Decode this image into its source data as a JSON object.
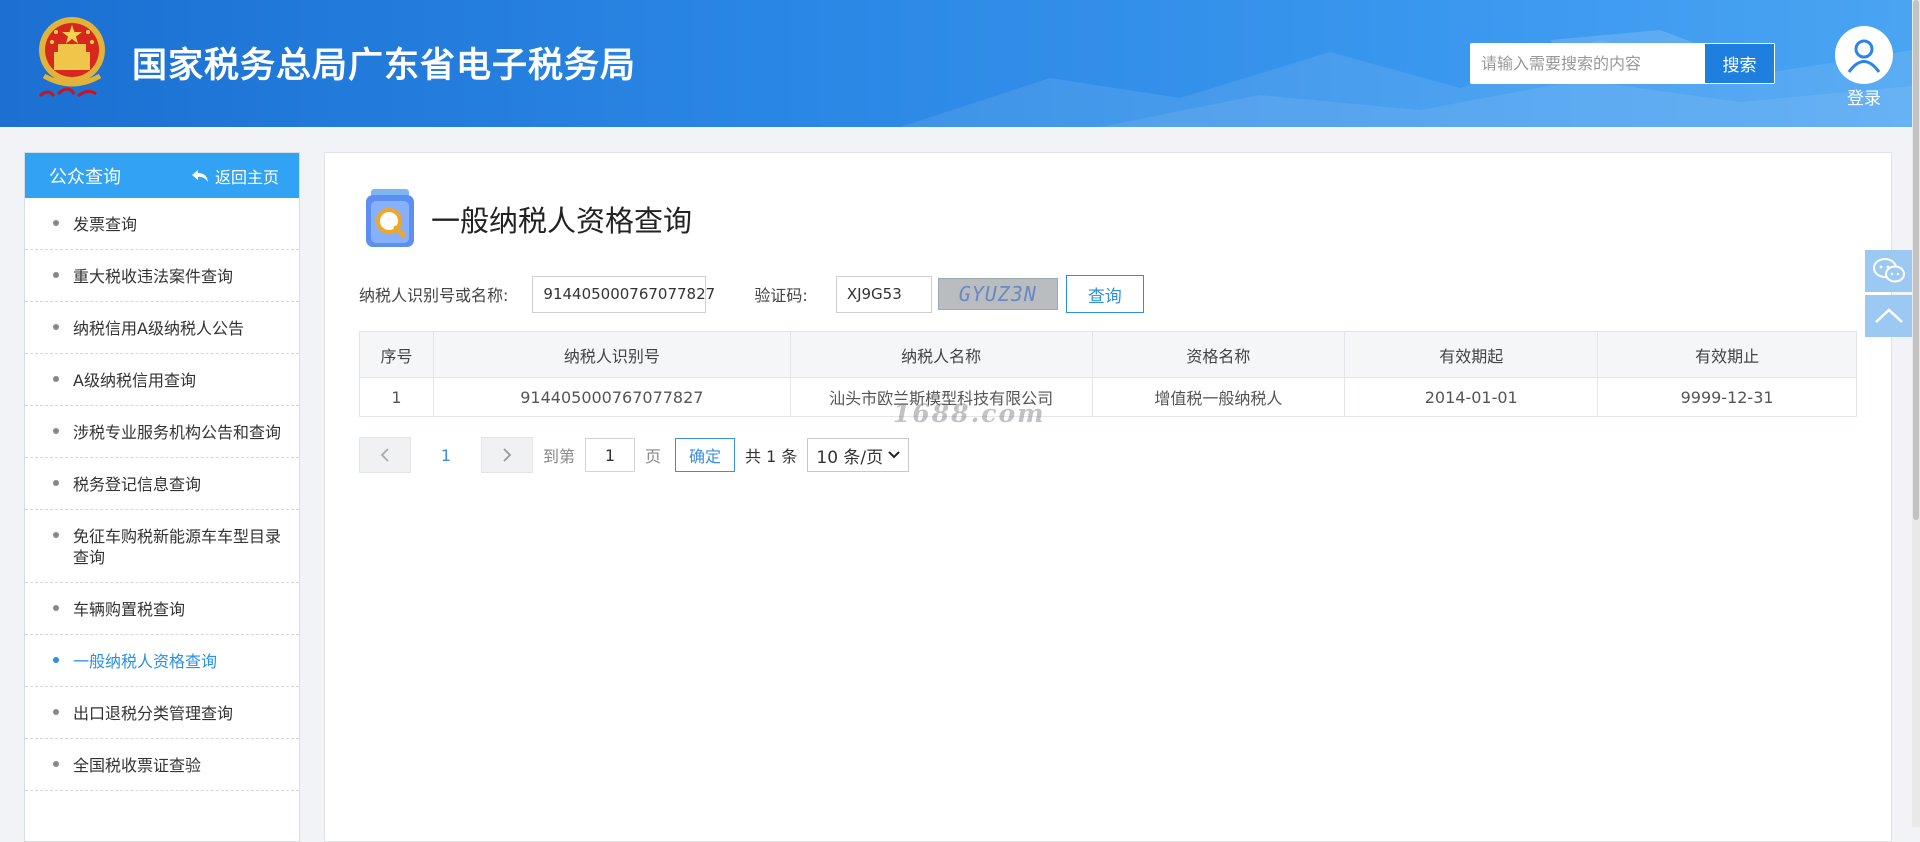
{
  "header": {
    "emblem_text": "中国税务",
    "site_title": "国家税务总局广东省电子税务局",
    "search": {
      "placeholder": "请输入需要搜索的内容",
      "button_label": "搜索"
    },
    "login_label": "登录"
  },
  "sidebar": {
    "title": "公众查询",
    "back_label": "返回主页",
    "items": [
      {
        "label": "发票查询"
      },
      {
        "label": "重大税收违法案件查询"
      },
      {
        "label": "纳税信用A级纳税人公告"
      },
      {
        "label": "A级纳税信用查询"
      },
      {
        "label": "涉税专业服务机构公告和查询"
      },
      {
        "label": "税务登记信息查询"
      },
      {
        "label": "免征车购税新能源车车型目录查询"
      },
      {
        "label": "车辆购置税查询"
      },
      {
        "label": "一般纳税人资格查询",
        "active": true
      },
      {
        "label": "出口退税分类管理查询"
      },
      {
        "label": "全国税收票证查验"
      }
    ]
  },
  "main": {
    "title": "一般纳税人资格查询",
    "form": {
      "taxpayer_label": "纳税人识别号或名称:",
      "taxpayer_value": "914405000767077827",
      "captcha_label": "验证码:",
      "captcha_value": "XJ9G53",
      "captcha_image_text": "GYUZ3N",
      "query_button": "查询"
    },
    "table": {
      "headers": [
        "序号",
        "纳税人识别号",
        "纳税人名称",
        "资格名称",
        "有效期起",
        "有效期止"
      ],
      "rows": [
        [
          "1",
          "914405000767077827",
          "汕头市欧兰斯模型科技有限公司",
          "增值税一般纳税人",
          "2014-01-01",
          "9999-12-31"
        ]
      ]
    },
    "watermark": "1688.com",
    "pager": {
      "current_page": "1",
      "goto_label": "到第",
      "goto_value": "1",
      "page_unit": "页",
      "confirm": "确定",
      "total": "共 1 条",
      "page_size": "10 条/页"
    }
  },
  "colors": {
    "header_blue": "#2a86e4",
    "sidebar_head": "#32a3f4",
    "link_active": "#2a90e6",
    "float_btn": "#9cc9f2"
  }
}
